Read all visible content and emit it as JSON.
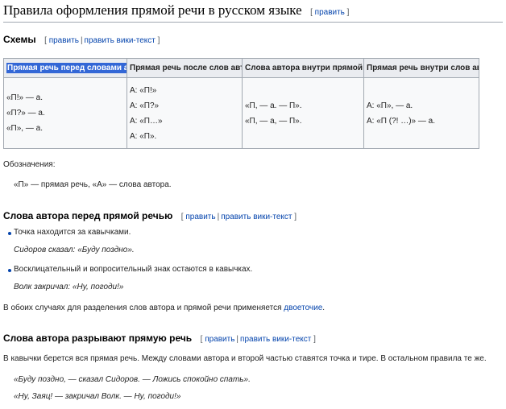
{
  "page": {
    "title": "Правила оформления прямой речи в русском языке",
    "edit_label": "править"
  },
  "edit_links": {
    "edit": "править",
    "edit_wikitext": "править вики-текст"
  },
  "section_schemes": {
    "heading": "Схемы",
    "table": {
      "headers": [
        "Прямая речь перед словами автора",
        "Прямая речь после слов автора",
        "Слова автора внутри прямой речи",
        "Прямая речь внутри слов автора"
      ],
      "columns": [
        [
          "«П!» — а.",
          "«П?» — а.",
          "«П», — а."
        ],
        [
          "А: «П!»",
          "А: «П?»",
          "А: «П…»",
          "А: «П»."
        ],
        [
          "«П, — а. — П».",
          "«П, — а, — П»."
        ],
        [
          "А: «П», — а.",
          "А: «П (?! …)» — а."
        ]
      ]
    },
    "legend_label": "Обозначения:",
    "legend_text": "«П» — прямая речь, «А» — слова автора."
  },
  "section_before": {
    "heading": "Слова автора перед прямой речью",
    "bullets": [
      {
        "text": "Точка находится за кавычками.",
        "example": "Сидоров сказал: «Буду поздно»."
      },
      {
        "text": "Восклицательный и вопросительный знак остаются в кавычках.",
        "example": "Волк закричал: «Ну, погоди!»"
      }
    ],
    "summary_prefix": "В обоих случаях для разделения слов автора и прямой речи применяется ",
    "summary_link": "двоеточие",
    "summary_suffix": "."
  },
  "section_break": {
    "heading": "Слова автора разрывают прямую речь",
    "text": "В кавычки берется вся прямая речь. Между словами автора и второй частью ставятся точка и тире. В остальном правила те же.",
    "examples": [
      "«Буду поздно, — сказал Сидоров. — Ложись спокойно спать».",
      "«Ну, Заяц! — закричал Волк. — Ну, погоди!»"
    ]
  },
  "colors": {
    "link": "#0645ad",
    "table_border": "#a2a9b1",
    "header_bg": "#eaecf0",
    "selection": "#3367d6"
  }
}
